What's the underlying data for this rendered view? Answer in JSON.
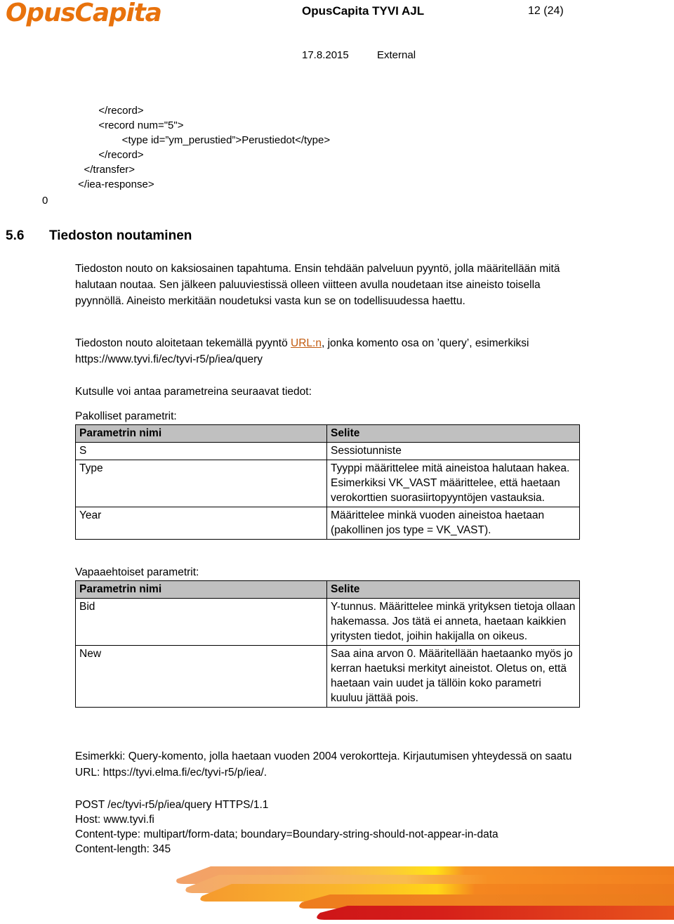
{
  "header": {
    "logo_text": "OpusCapita",
    "document_title": "OpusCapita TYVI AJL",
    "page_number": "12 (24)",
    "date": "17.8.2015",
    "classification": "External"
  },
  "code_block": {
    "text": "        </record>\n        <record num=\"5\">\n                <type id=”ym_perustied”>Perustiedot</type>\n        </record>\n   </transfer>\n </iea-response>"
  },
  "stray_marker": "0",
  "section": {
    "number": "5.6",
    "title": "Tiedoston noutaminen"
  },
  "paragraphs": {
    "intro": "Tiedoston nouto on kaksiosainen tapahtuma. Ensin tehdään palveluun pyyntö, jolla määritellään mitä halutaan noutaa. Sen jälkeen paluuviestissä olleen viitteen avulla noudetaan itse aineisto toisella pyynnöllä. Aineisto merkitään noudetuksi vasta kun se on todellisuudessa haettu.",
    "url_prefix": "Tiedoston nouto aloitetaan tekemällä pyyntö ",
    "url_link": "URL:n",
    "url_suffix": ", jonka komento osa on ’query’, esimerkiksi https://www.tyvi.fi/ec/tyvi-r5/p/iea/query",
    "params_intro": "Kutsulle voi antaa parametreina seuraavat tiedot:",
    "mandatory_label": "Pakolliset parametrit:",
    "optional_label": "Vapaaehtoiset parametrit:",
    "example": "Esimerkki: Query-komento, jolla haetaan vuoden 2004 verokortteja. Kirjautumisen yhteydessä on saatu URL: https://tyvi.elma.fi/ec/tyvi-r5/p/iea/."
  },
  "mandatory_table": {
    "headers": [
      "Parametrin nimi",
      "Selite"
    ],
    "rows": [
      {
        "name": "S",
        "desc": "Sessiotunniste"
      },
      {
        "name": "Type",
        "desc": "Tyyppi määrittelee mitä aineistoa halutaan hakea. Esimerkiksi VK_VAST määrittelee, että haetaan verokorttien suorasiirtopyyntöjen vastauksia."
      },
      {
        "name": "Year",
        "desc": "Määrittelee minkä vuoden aineistoa haetaan (pakollinen jos type = VK_VAST)."
      }
    ]
  },
  "optional_table": {
    "headers": [
      "Parametrin nimi",
      "Selite"
    ],
    "rows": [
      {
        "name": "Bid",
        "desc": "Y-tunnus. Määrittelee minkä yrityksen tietoja ollaan hakemassa. Jos tätä ei anneta, haetaan kaikkien yritysten tiedot, joihin hakijalla on oikeus."
      },
      {
        "name": "New",
        "desc": "Saa aina arvon 0. Määritellään haetaanko myös jo kerran haetuksi merkityt aineistot. Oletus on, että haetaan vain uudet ja tällöin koko parametri kuuluu jättää pois."
      }
    ]
  },
  "post_block": {
    "text": "POST /ec/tyvi-r5/p/iea/query HTTPS/1.1\nHost: www.tyvi.fi\nContent-type: multipart/form-data; boundary=Boundary-string-should-not-appear-in-data\nContent-length: 345"
  },
  "colors": {
    "brand_orange": "#E8720C",
    "link_orange": "#C25B10",
    "table_header_gray": "#C0C0C0",
    "footer_yellow": "#FFD91C",
    "footer_orange": "#F07E1E",
    "footer_red": "#D31A1A"
  }
}
